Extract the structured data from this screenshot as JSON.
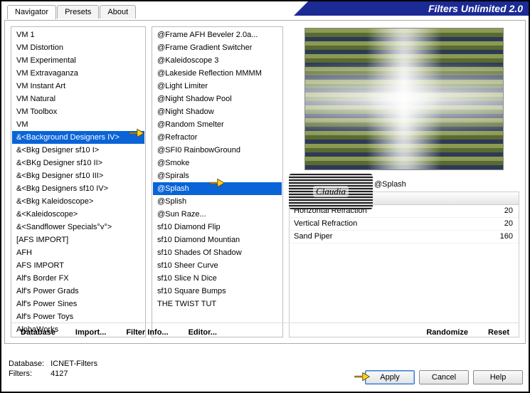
{
  "title": "Filters Unlimited 2.0",
  "tabs": [
    "Navigator",
    "Presets",
    "About"
  ],
  "active_tab_index": 0,
  "categories": {
    "selected_index": 8,
    "items": [
      "VM 1",
      "VM Distortion",
      "VM Experimental",
      "VM Extravaganza",
      "VM Instant Art",
      "VM Natural",
      "VM Toolbox",
      "VM",
      "&<Background Designers IV>",
      "&<Bkg Designer sf10 I>",
      "&<BKg Designer sf10 II>",
      "&<Bkg Designer sf10 III>",
      "&<Bkg Designers sf10 IV>",
      "&<Bkg Kaleidoscope>",
      "&<Kaleidoscope>",
      "&<Sandflower Specials°v°>",
      "[AFS IMPORT]",
      "AFH",
      "AFS IMPORT",
      "Alf's Border FX",
      "Alf's Power Grads",
      "Alf's Power Sines",
      "Alf's Power Toys",
      "AlphaWorks"
    ]
  },
  "filters": {
    "selected_index": 12,
    "items": [
      "@Frame AFH Beveler 2.0a...",
      "@Frame Gradient Switcher",
      "@Kaleidoscope 3",
      "@Lakeside Reflection MMMM",
      "@Light Limiter",
      "@Night Shadow Pool",
      "@Night Shadow",
      "@Random Smelter",
      "@Refractor",
      "@SFI0 RainbowGround",
      "@Smoke",
      "@Spirals",
      "@Splash",
      "@Splish",
      "@Sun Raze...",
      "sf10 Diamond Flip",
      "sf10 Diamond Mountian",
      "sf10 Shades Of Shadow",
      "sf10 Sheer Curve",
      "sf10 Slice N Dice",
      "sf10 Square Bumps",
      "THE TWIST TUT"
    ]
  },
  "current_filter": "@Splash",
  "params": [
    {
      "name": "Horizontal Refraction",
      "value": 20
    },
    {
      "name": "Vertical Refraction",
      "value": 20
    },
    {
      "name": "Sand Piper",
      "value": 160
    }
  ],
  "toolbar": {
    "database": "Database",
    "import": "Import...",
    "filter_info": "Filter Info...",
    "editor": "Editor...",
    "randomize": "Randomize",
    "reset": "Reset"
  },
  "buttons": {
    "apply": "Apply",
    "cancel": "Cancel",
    "help": "Help"
  },
  "meta": {
    "db_label": "Database:",
    "db_value": "ICNET-Filters",
    "filters_label": "Filters:",
    "filters_value": "4127"
  },
  "watermark": "Claudia"
}
